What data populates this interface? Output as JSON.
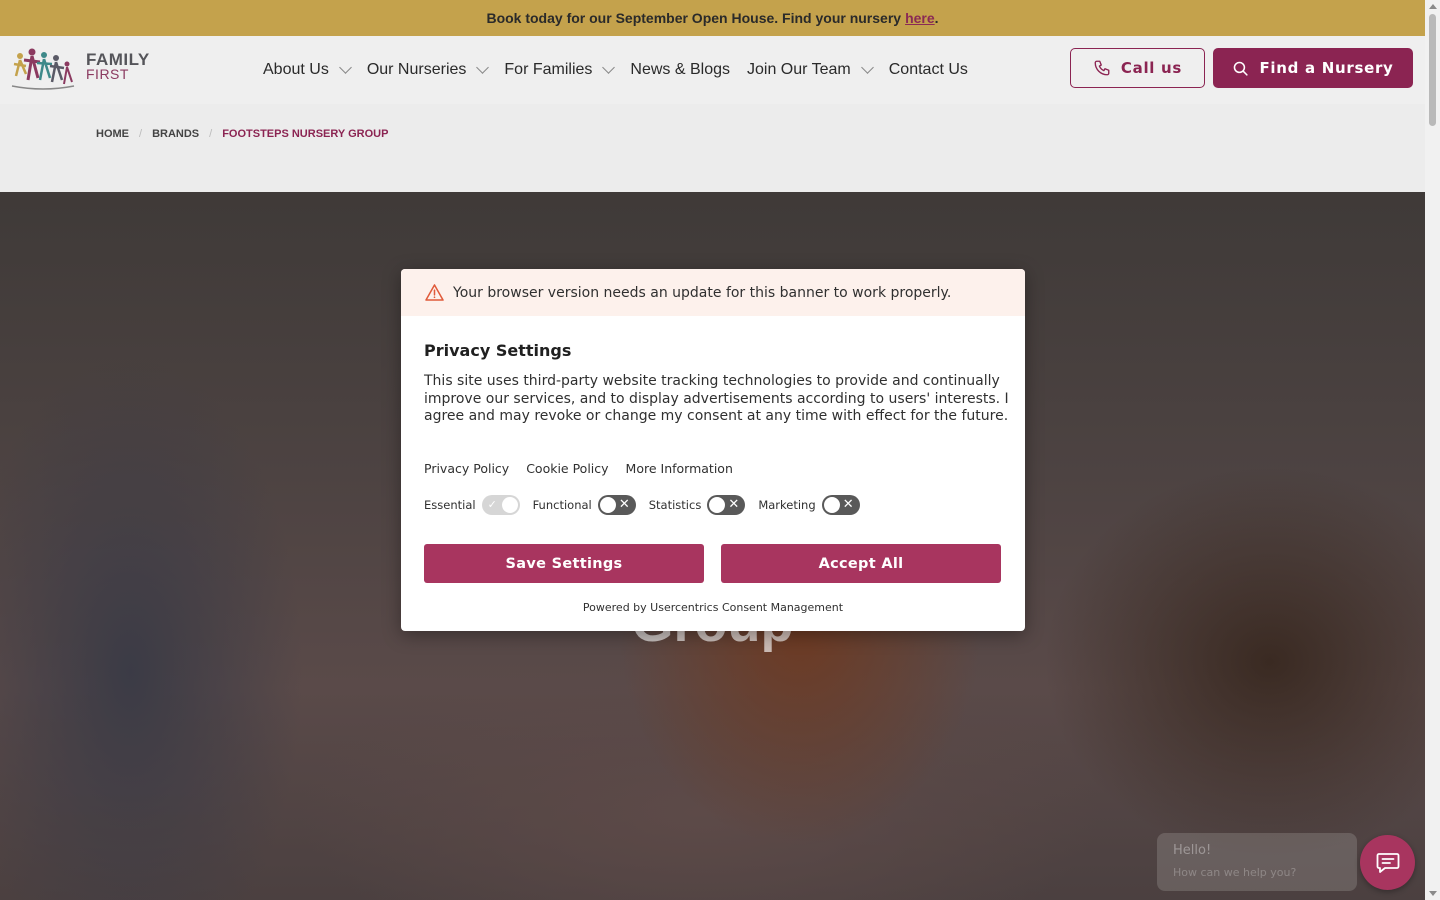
{
  "announcement": {
    "text": "Book today for our September Open House. Find your nursery",
    "link": "here",
    "end": "."
  },
  "logo": {
    "line1": "FAMILY",
    "line2": "FIRST"
  },
  "nav": {
    "about": "About Us",
    "nurseries": "Our Nurseries",
    "families": "For Families",
    "news": "News & Blogs",
    "join": "Join Our Team",
    "contact": "Contact Us"
  },
  "header": {
    "call_label": "Call us",
    "find_label": "Find a Nursery"
  },
  "breadcrumb": {
    "home": "HOME",
    "brands": "BRANDS",
    "current": "FOOTSTEPS NURSERY GROUP"
  },
  "hero": {
    "title_visible": "Group"
  },
  "consent": {
    "warning": "Your browser version needs an update for this banner to work properly.",
    "title": "Privacy Settings",
    "description": "This site uses third-party website tracking technologies to provide and continually improve our services, and to display advertisements according to users' interests. I agree and may revoke or change my consent at any time with effect for the future.",
    "links": {
      "privacy": "Privacy Policy",
      "cookie": "Cookie Policy",
      "more": "More Information"
    },
    "toggles": {
      "essential": "Essential",
      "functional": "Functional",
      "statistics": "Statistics",
      "marketing": "Marketing"
    },
    "save_label": "Save Settings",
    "accept_label": "Accept All",
    "powered": "Powered by Usercentrics Consent Management"
  },
  "chat": {
    "greeting": "Hello!",
    "prompt": "How can we help you?"
  },
  "colors": {
    "brand": "#8b2452",
    "consent_button": "#a8355f",
    "announcement_bg": "#c4a24c"
  }
}
